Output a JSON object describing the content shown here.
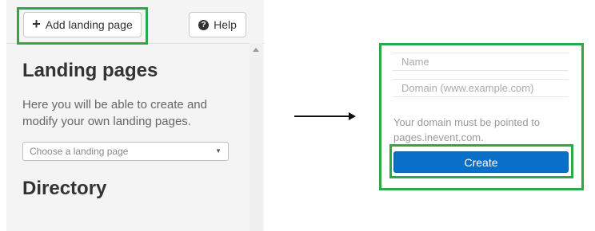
{
  "toolbar": {
    "add_label": "Add landing page",
    "help_label": "Help"
  },
  "left": {
    "title": "Landing pages",
    "description": "Here you will be able to create and modify your own landing pages.",
    "select_placeholder": "Choose a landing page",
    "section_title": "Directory"
  },
  "form": {
    "name_placeholder": "Name",
    "domain_placeholder": "Domain (www.example.com)",
    "note": "Your domain must be pointed to pages.inevent.com.",
    "create_label": "Create"
  },
  "colors": {
    "highlight": "#2aa84a",
    "primary_button": "#0a6fc9"
  },
  "icons": {
    "add": "plus-icon",
    "help": "question-circle-icon",
    "select": "caret-down-icon",
    "arrow": "arrow-right-icon"
  }
}
